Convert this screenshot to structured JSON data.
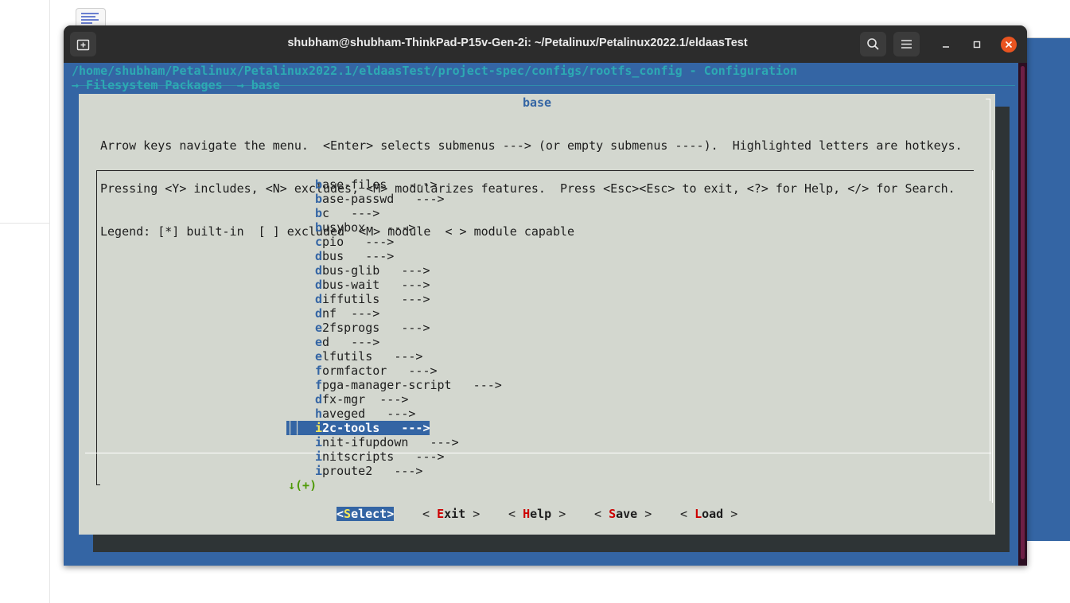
{
  "window": {
    "title": "shubham@shubham-ThinkPad-P15v-Gen-2i: ~/Petalinux/Petalinux2022.1/eldaasTest"
  },
  "desktop": {
    "terminal_icon_glyph": ">_"
  },
  "terminal": {
    "path": "/home/shubham/Petalinux/Petalinux2022.1/eldaasTest/project-spec/configs/rootfs_config - Configuration",
    "breadcrumb": "→ Filesystem Packages  → base",
    "dialog_title": "base",
    "help_lines": [
      "Arrow keys navigate the menu.  <Enter> selects submenus ---> (or empty submenus ----).  Highlighted letters are hotkeys.",
      "Pressing <Y> includes, <N> excludes, <M> modularizes features.  Press <Esc><Esc> to exit, <?> for Help, </> for Search.",
      "Legend: [*] built-in  [ ] excluded  <M> module  < > module capable"
    ],
    "selected_bars": "││ ",
    "items": [
      {
        "hk": "b",
        "rest": "ase-files   --->"
      },
      {
        "hk": "b",
        "rest": "ase-passwd   --->"
      },
      {
        "hk": "b",
        "rest": "c   --->"
      },
      {
        "hk": "b",
        "rest": "usybox   --->"
      },
      {
        "hk": "c",
        "rest": "pio   --->"
      },
      {
        "hk": "d",
        "rest": "bus   --->"
      },
      {
        "hk": "d",
        "rest": "bus-glib   --->"
      },
      {
        "hk": "d",
        "rest": "bus-wait   --->"
      },
      {
        "hk": "d",
        "rest": "iffutils   --->"
      },
      {
        "hk": "d",
        "rest": "nf  --->"
      },
      {
        "hk": "e",
        "rest": "2fsprogs   --->"
      },
      {
        "hk": "e",
        "rest": "d   --->"
      },
      {
        "hk": "e",
        "rest": "lfutils   --->"
      },
      {
        "hk": "f",
        "rest": "ormfactor   --->"
      },
      {
        "hk": "f",
        "rest": "pga-manager-script   --->"
      },
      {
        "hk": "d",
        "rest": "fx-mgr  --->"
      },
      {
        "hk": "h",
        "rest": "aveged   --->"
      },
      {
        "hk": "i",
        "rest": "2c-tools   --->"
      },
      {
        "hk": "i",
        "rest": "nit-ifupdown   --->"
      },
      {
        "hk": "i",
        "rest": "nitscripts   --->"
      },
      {
        "hk": "i",
        "rest": "proute2   --->"
      }
    ],
    "selected_index": 17,
    "more_indicator": "↓(+)",
    "buttons": [
      {
        "pre": "<",
        "hk": "S",
        "rest": "elect",
        "post": ">"
      },
      {
        "pre": "< ",
        "hk": "E",
        "rest": "xit",
        "post": " >"
      },
      {
        "pre": "< ",
        "hk": "H",
        "rest": "elp",
        "post": " >"
      },
      {
        "pre": "< ",
        "hk": "S",
        "rest": "ave",
        "post": " >"
      },
      {
        "pre": "< ",
        "hk": "L",
        "rest": "oad",
        "post": " >"
      }
    ]
  },
  "colors": {
    "terminal_bg": "#3465a4",
    "dialog_bg": "#d3d7cf",
    "hotkey_blue": "#3465a4",
    "button_hotkey_red": "#cc0000",
    "selected_hotkey_yellow": "#f5e85a",
    "path_cyan": "#2da9b3",
    "more_green": "#4e9a06",
    "close_orange": "#e95420"
  },
  "icons": [
    "new-tab-icon",
    "search-icon",
    "hamburger-menu-icon",
    "minimize-icon",
    "maximize-icon",
    "close-icon"
  ]
}
